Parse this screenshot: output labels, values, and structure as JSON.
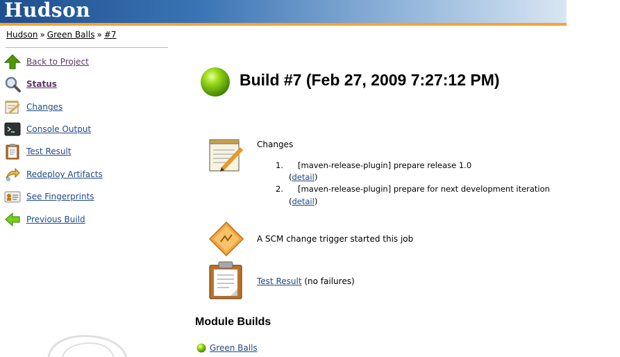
{
  "header": {
    "logo_text": "Hudson"
  },
  "breadcrumb": {
    "items": [
      "Hudson",
      "Green Balls",
      "#7"
    ],
    "separator": "»"
  },
  "sidebar": {
    "items": [
      {
        "label": "Back to Project",
        "icon": "up-arrow-icon"
      },
      {
        "label": "Status",
        "icon": "magnifier-icon"
      },
      {
        "label": "Changes",
        "icon": "notepad-icon"
      },
      {
        "label": "Console Output",
        "icon": "terminal-icon"
      },
      {
        "label": "Test Result",
        "icon": "clipboard-icon"
      },
      {
        "label": "Redeploy Artifacts",
        "icon": "redeploy-arrow-icon"
      },
      {
        "label": "See Fingerprints",
        "icon": "fingerprint-card-icon"
      },
      {
        "label": "Previous Build",
        "icon": "left-arrow-icon"
      }
    ]
  },
  "build": {
    "title": "Build #7 (Feb 27, 2009 7:27:12 PM)",
    "status_color": "#5aa600"
  },
  "changes": {
    "label": "Changes",
    "items": [
      {
        "num": "1.",
        "message": "[maven-release-plugin] prepare release 1.0",
        "detail_label": "detail"
      },
      {
        "num": "2.",
        "message": "[maven-release-plugin] prepare for next development iteration",
        "detail_label": "detail"
      }
    ]
  },
  "cause": {
    "text": "A SCM change trigger started this job"
  },
  "test_result": {
    "link_label": "Test Result",
    "suffix": "(no failures)"
  },
  "module_builds": {
    "heading": "Module Builds",
    "items": [
      {
        "label": "Green Balls"
      }
    ]
  },
  "colors": {
    "header_blue": "#1e4f8e",
    "header_stripe": "#f7a330",
    "link": "#204a87",
    "visited": "#5c3566"
  }
}
